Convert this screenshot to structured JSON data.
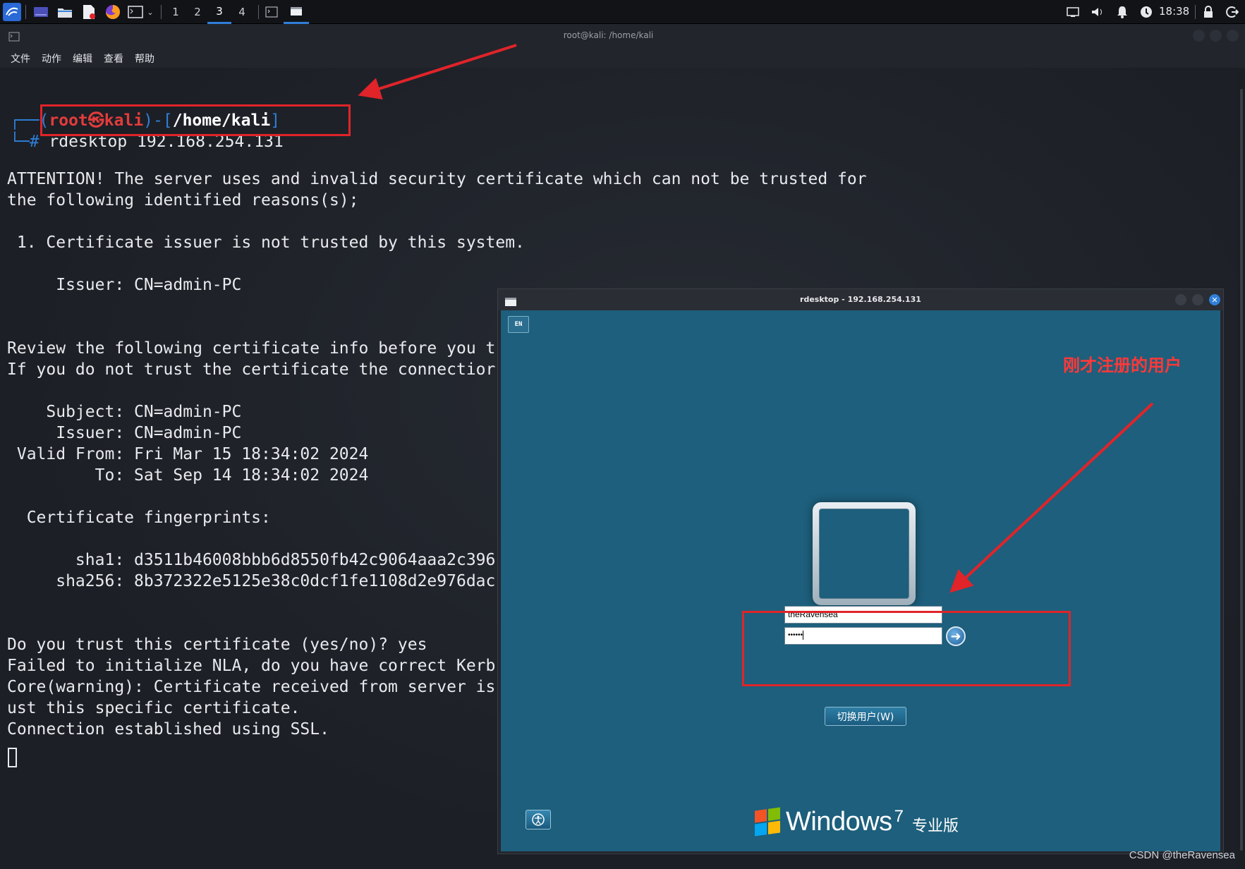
{
  "panel": {
    "workspaces": [
      "1",
      "2",
      "3",
      "4"
    ],
    "active_workspace": "3",
    "clock": "18:38"
  },
  "terminal": {
    "title": "root@kali: /home/kali",
    "menu": [
      "文件",
      "动作",
      "编辑",
      "查看",
      "帮助"
    ],
    "prompt": {
      "open": "┌──(",
      "user_host": "root㉿kali",
      "mid": ")-[",
      "path": "/home/kali",
      "close": "]",
      "hash": "└─#",
      "command": "rdesktop 192.168.254.131"
    },
    "lines": [
      "ATTENTION! The server uses and invalid security certificate which can not be trusted for",
      "the following identified reasons(s);",
      "",
      " 1. Certificate issuer is not trusted by this system.",
      "",
      "     Issuer: CN=admin-PC",
      "",
      "",
      "Review the following certificate info before you t",
      "If you do not trust the certificate the connectior",
      "",
      "    Subject: CN=admin-PC",
      "     Issuer: CN=admin-PC",
      " Valid From: Fri Mar 15 18:34:02 2024",
      "         To: Sat Sep 14 18:34:02 2024",
      "",
      "  Certificate fingerprints:",
      "",
      "       sha1: d3511b46008bbb6d8550fb42c9064aaa2c396",
      "     sha256: 8b372322e5125e38c0dcf1fe1108d2e976dac",
      "",
      "",
      "Do you trust this certificate (yes/no)? yes",
      "Failed to initialize NLA, do you have correct Kerb",
      "Core(warning): Certificate received from server is",
      "ust this specific certificate.",
      "Connection established using SSL."
    ]
  },
  "rdp": {
    "title": "rdesktop - 192.168.254.131",
    "lang_indicator": "EN",
    "username": "theRavensea",
    "password_mask": "••••••",
    "switch_user_label": "切换用户(W)",
    "brand_name": "Windows",
    "brand_version": "7",
    "brand_edition": "专业版"
  },
  "annotation": {
    "text": "刚才注册的用户",
    "color": "#e0242a"
  },
  "watermark": "CSDN @theRavensea"
}
